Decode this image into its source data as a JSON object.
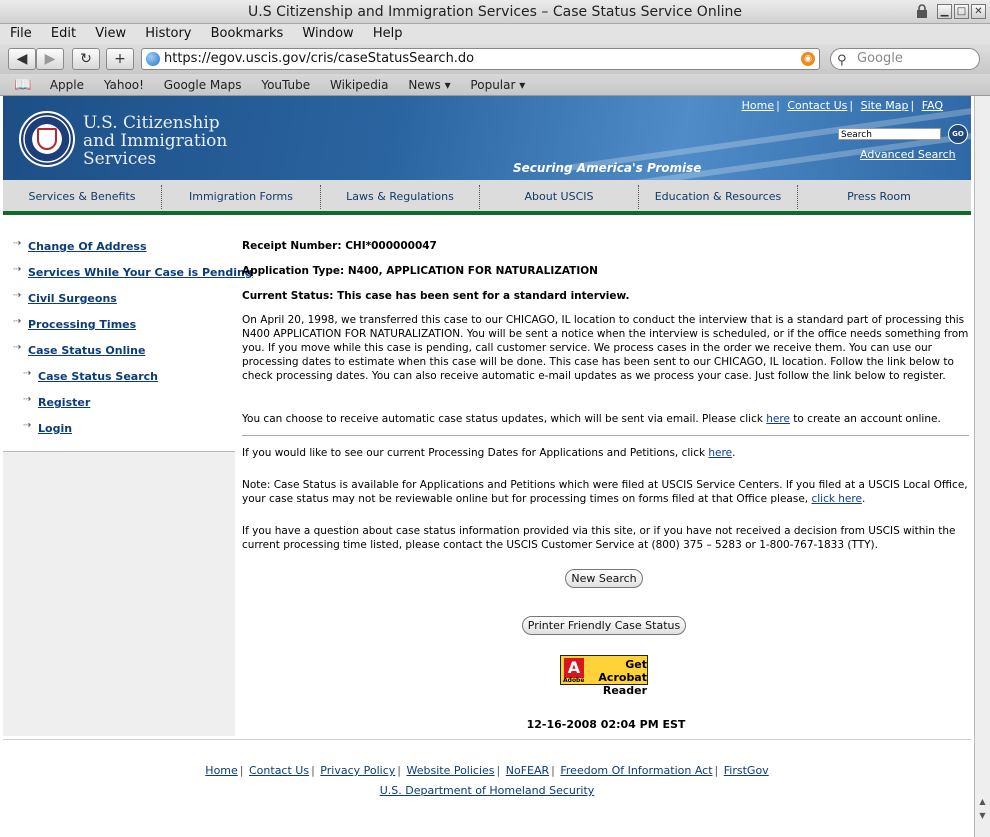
{
  "window": {
    "title": "U.S Citizenship and Immigration Services – Case Status Service Online"
  },
  "menu": [
    "File",
    "Edit",
    "View",
    "History",
    "Bookmarks",
    "Window",
    "Help"
  ],
  "browser": {
    "url": "https://egov.uscis.gov/cris/caseStatusSearch.do",
    "search_placeholder": "Google",
    "bookmarks": [
      "Apple",
      "Yahoo!",
      "Google Maps",
      "YouTube",
      "Wikipedia",
      "News ▾",
      "Popular ▾"
    ]
  },
  "header": {
    "agency_lines": [
      "U.S. Citizenship",
      "and Immigration",
      "Services"
    ],
    "tagline": "Securing America's Promise",
    "toplinks": [
      "Home",
      "Contact Us",
      "Site Map",
      "FAQ"
    ],
    "search_value": "Search",
    "go_label": "GO",
    "advanced_search": "Advanced Search"
  },
  "mainnav": [
    "Services & Benefits",
    "Immigration Forms",
    "Laws & Regulations",
    "About USCIS",
    "Education & Resources",
    "Press Room"
  ],
  "sidebar": {
    "items": [
      "Change Of Address",
      "Services While Your Case is Pending",
      "Civil Surgeons",
      "Processing Times",
      "Case Status Online"
    ],
    "subitems": [
      "Case Status Search",
      "Register",
      "Login"
    ]
  },
  "content": {
    "receipt": "Receipt Number: CHI*000000047",
    "app_type": "Application Type: N400, APPLICATION FOR NATURALIZATION",
    "status": "Current Status: This case has been sent for a standard interview.",
    "body": "On April 20, 1998, we transferred this case to our CHICAGO, IL location to conduct the interview that is a standard part of processing this N400 APPLICATION FOR NATURALIZATION. You will be sent a notice when the interview is scheduled, or if the office needs something from you. If you move while this case is pending, call customer service. We process cases in the order we receive them. You can use our processing dates to estimate when this case will be done. This case has been sent to our CHICAGO, IL location. Follow the link below to check processing dates. You can also receive automatic e-mail updates as we process your case. Just follow the link below to register.",
    "email_pre": "You can choose to receive automatic case status updates, which will be sent via email. Please click ",
    "email_link": "here",
    "email_post": " to create an account online.",
    "proc_pre": "If you would like to see our current Processing Dates for Applications and Petitions, click ",
    "proc_link": "here",
    "proc_post": ".",
    "note_pre": "Note: Case Status is available for Applications and Petitions which were filed at USCIS Service Centers. If you filed at a USCIS Local Office, your case status may not be reviewable online but for processing times on forms filed at that Office please, ",
    "note_link": "click here",
    "note_post": ".",
    "question": "If you have a question about case status information provided via this site, or if you have not received a decision from USCIS within the current processing time listed, please contact the USCIS Customer Service at (800) 375 – 5283 or 1-800-767-1833 (TTY).",
    "new_search": "New Search",
    "printer": "Printer Friendly Case Status",
    "acrobat_line1": "Get Acrobat",
    "acrobat_line2": "Reader",
    "acrobat_brand": "Adobe",
    "timestamp": "12-16-2008 02:04 PM EST"
  },
  "footer": {
    "links": [
      "Home",
      "Contact Us",
      "Privacy Policy",
      "Website Policies",
      "NoFEAR",
      "Freedom Of Information Act",
      "FirstGov"
    ],
    "dhs": "U.S. Department of Homeland Security"
  }
}
